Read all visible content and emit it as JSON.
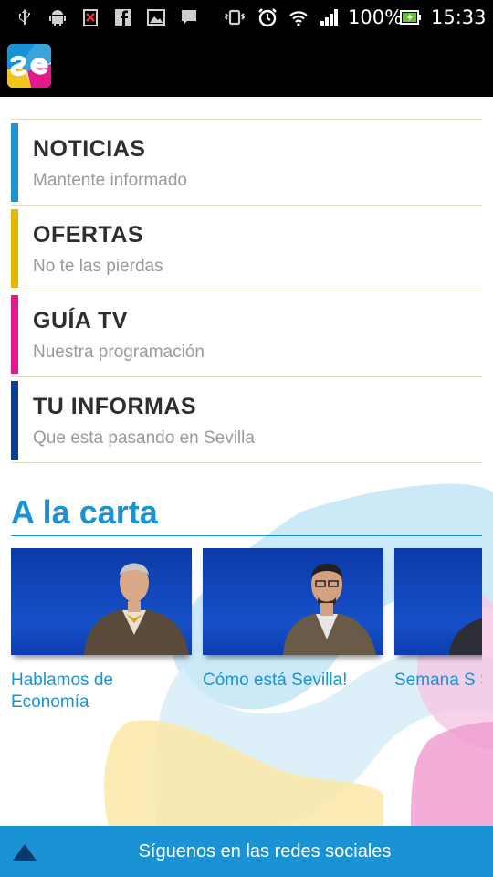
{
  "status_bar": {
    "battery": "100%",
    "time": "15:33",
    "icons": [
      "usb-icon",
      "android-debug-icon",
      "no-sim-icon",
      "facebook-icon",
      "image-icon",
      "chat-icon",
      "vibrate-icon",
      "alarm-icon",
      "wifi-icon",
      "signal-icon",
      "battery-icon"
    ]
  },
  "app": {
    "logo_text": "se",
    "logo_colors": [
      "#1a93d5",
      "#f0c419",
      "#e5178c"
    ]
  },
  "menu": {
    "items": [
      {
        "title": "NOTICIAS",
        "subtitle": "Mantente informado",
        "color": "#1a93d5"
      },
      {
        "title": "OFERTAS",
        "subtitle": "No te las pierdas",
        "color": "#e6b800"
      },
      {
        "title": "GUÍA TV",
        "subtitle": "Nuestra programación",
        "color": "#e5178c"
      },
      {
        "title": "TU INFORMAS",
        "subtitle": "Que esta pasando en Sevilla",
        "color": "#0b3f8f"
      }
    ]
  },
  "carta": {
    "title": "A la carta",
    "cards": [
      {
        "title": "Hablamos de Economía"
      },
      {
        "title": "Cómo está Sevilla!"
      },
      {
        "title": "Semana S Sevilla"
      }
    ]
  },
  "footer": {
    "label": "Síguenos en las redes sociales",
    "icon": "triangle-up-icon"
  }
}
